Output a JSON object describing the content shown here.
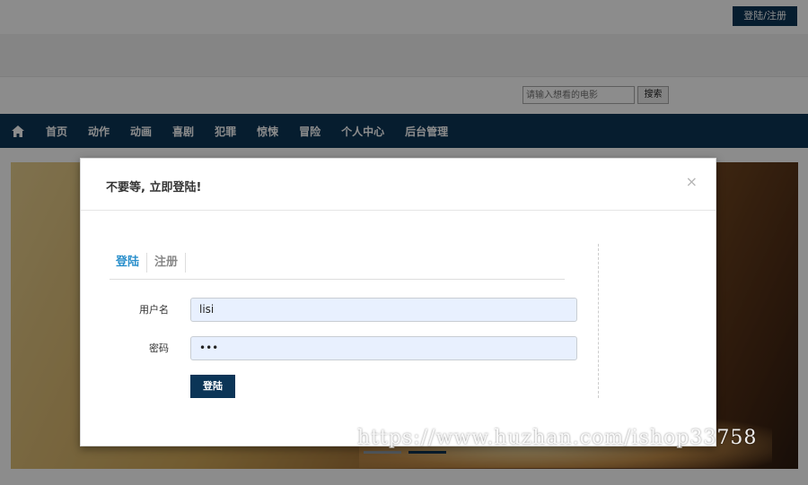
{
  "topbar": {
    "login_register": "登陆/注册"
  },
  "search": {
    "placeholder": "请输入想看的电影",
    "button": "搜索"
  },
  "nav": {
    "home_icon": "home-icon",
    "items": [
      "首页",
      "动作",
      "动画",
      "喜剧",
      "犯罪",
      "惊悚",
      "冒险",
      "个人中心",
      "后台管理"
    ]
  },
  "modal": {
    "title": "不要等, 立即登陆!",
    "close": "×",
    "tabs": [
      {
        "label": "登陆",
        "active": true
      },
      {
        "label": "注册",
        "active": false
      }
    ],
    "username_label": "用户名",
    "username_value": "lisi",
    "password_label": "密码",
    "password_value": "•••",
    "submit": "登陆"
  },
  "watermark": "https://www.huzhan.com/ishop33758",
  "colors": {
    "brand": "#0b3557",
    "tab_active": "#2a8fcb",
    "input_bg": "#e8f0fe"
  }
}
